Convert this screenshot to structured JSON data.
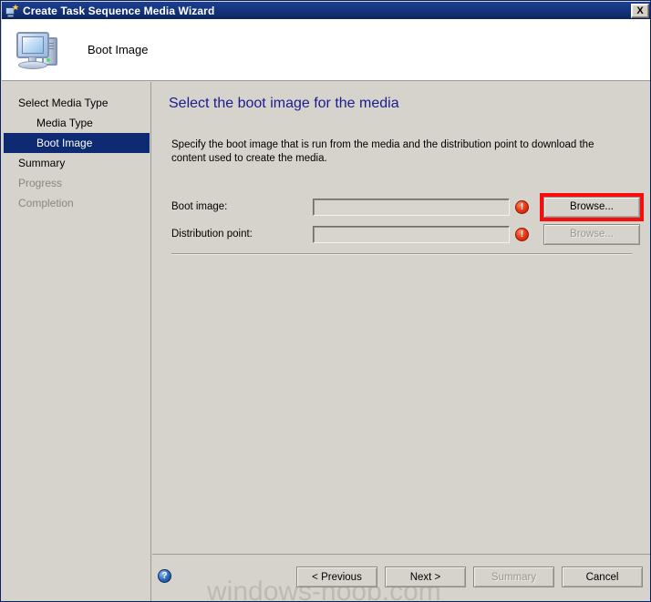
{
  "window": {
    "title": "Create Task Sequence Media Wizard",
    "title_icon": "wizard-media-icon",
    "close_label": "X"
  },
  "header": {
    "title": "Boot Image",
    "icon": "computer-icon"
  },
  "sidebar": {
    "items": [
      {
        "label": "Select Media Type",
        "indent": false,
        "state": "normal"
      },
      {
        "label": "Media Type",
        "indent": true,
        "state": "normal"
      },
      {
        "label": "Boot Image",
        "indent": true,
        "state": "selected"
      },
      {
        "label": "Summary",
        "indent": false,
        "state": "normal"
      },
      {
        "label": "Progress",
        "indent": false,
        "state": "dim"
      },
      {
        "label": "Completion",
        "indent": false,
        "state": "dim"
      }
    ]
  },
  "content": {
    "heading": "Select the boot image for the media",
    "description": "Specify the boot image that is run from the media and the distribution point to download the content used to create the media.",
    "fields": [
      {
        "label": "Boot image:",
        "value": "",
        "placeholder": "",
        "error_icon": "error-icon",
        "button_label": "Browse...",
        "button_disabled": false,
        "highlighted": true
      },
      {
        "label": "Distribution point:",
        "value": "",
        "placeholder": "",
        "error_icon": "error-icon",
        "button_label": "Browse...",
        "button_disabled": true,
        "highlighted": false
      }
    ]
  },
  "footer": {
    "help_icon": "help-icon",
    "buttons": [
      {
        "label": "< Previous",
        "disabled": false
      },
      {
        "label": "Next >",
        "disabled": false
      },
      {
        "label": "Summary",
        "disabled": true
      },
      {
        "label": "Cancel",
        "disabled": false
      }
    ]
  },
  "watermark": "windows-noob.com",
  "colors": {
    "titlebar": "#17357e",
    "dialog_bg": "#d6d3cd",
    "heading": "#1c1c8c",
    "selection": "#0e2a72",
    "error": "#ee3b16",
    "highlight_box": "#fa0c0c"
  }
}
